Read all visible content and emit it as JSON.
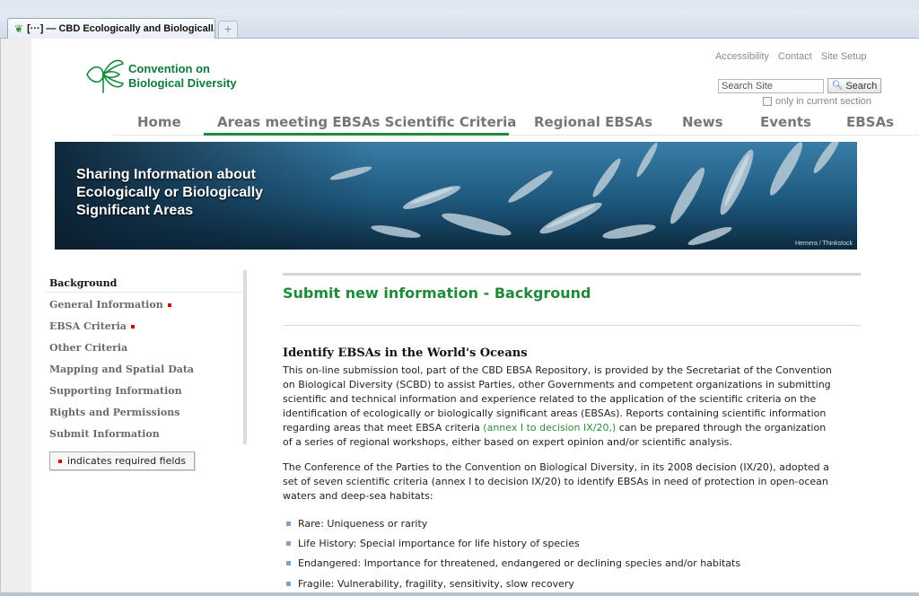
{
  "browser": {
    "tab_title": "[···] — CBD Ecologically and Biologicall...",
    "tab_icon": "cbd-leaf-icon",
    "new_tab_glyph": "+"
  },
  "header": {
    "logo_line1": "Convention on",
    "logo_line2": "Biological Diversity",
    "utility_links": [
      "Accessibility",
      "Contact",
      "Site Setup"
    ],
    "search": {
      "placeholder": "Search Site",
      "button_label": "Search",
      "only_current_label": "only in current section"
    }
  },
  "nav": {
    "items": [
      "Home",
      "Areas meeting EBSAs Scientific Criteria",
      "Regional EBSAs",
      "News",
      "Events",
      "EBSAs"
    ],
    "active": "Areas meeting EBSAs Scientific Criteria"
  },
  "banner": {
    "line1": "Sharing Information about",
    "line2": "Ecologically or Biologically",
    "line3": "Significant Areas",
    "credit": "Hemera / Thinkstock"
  },
  "left_menu": {
    "items": [
      {
        "label": "Background",
        "required": false,
        "active": true
      },
      {
        "label": "General Information",
        "required": true,
        "active": false
      },
      {
        "label": "EBSA Criteria",
        "required": true,
        "active": false
      },
      {
        "label": "Other Criteria",
        "required": false,
        "active": false
      },
      {
        "label": "Mapping and Spatial Data",
        "required": false,
        "active": false
      },
      {
        "label": "Supporting Information",
        "required": false,
        "active": false
      },
      {
        "label": "Rights and Permissions",
        "required": false,
        "active": false
      },
      {
        "label": "Submit Information",
        "required": false,
        "active": false
      }
    ],
    "legend": "indicates required fields",
    "required_color": "#d00000"
  },
  "content": {
    "title": "Submit new information - Background",
    "section_title": "Identify EBSAs in the World's Oceans",
    "para1_lines": [
      "This on-line submission tool, part of the CBD EBSA Repository, is provided by the Secretariat of the Convention",
      "on Biological Diversity (SCBD) to assist Parties, other Governments and competent organizations in submitting",
      "scientific and technical information and experience related to the application of the scientific criteria on the",
      "identification of ecologically or biologically significant areas (EBSAs). Reports containing scientific information"
    ],
    "para1_line5_before": "regarding areas that meet EBSA criteria ",
    "para1_link": "(annex I to decision IX/20,)",
    "para1_line5_after": " can be prepared through the organization",
    "para1_line6": "of a series of regional workshops, either based on expert opinion and/or scientific analysis.",
    "para2_lines": [
      "The Conference of the Parties to the Convention on Biological Diversity, in its 2008 decision (IX/20), adopted a",
      "set of seven scientific criteria (annex I to decision IX/20) to identify EBSAs in need of protection in open-ocean",
      "waters and deep-sea habitats:"
    ],
    "bullets": [
      "Rare: Uniqueness or rarity",
      "Life History: Special importance for life history of species",
      "Endangered: Importance for threatened, endangered or declining species and/or habitats",
      "Fragile: Vulnerability, fragility, sensitivity, slow recovery"
    ]
  },
  "colors": {
    "brand_green": "#1e8a3a",
    "link_green": "#2f8a3a",
    "required_red": "#d00000",
    "bullet_blue": "#7ea2c8"
  }
}
